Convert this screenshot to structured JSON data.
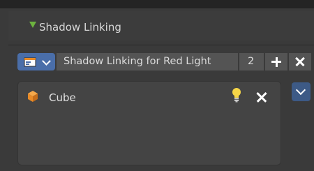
{
  "panel": {
    "title": "Shadow Linking"
  },
  "toolbar": {
    "collection_name": "Shadow Linking for Red Light",
    "user_count": "2",
    "add_icon": "plus-icon",
    "remove_icon": "close-icon"
  },
  "list": {
    "items": [
      {
        "label": "Cube",
        "type_icon": "cube-icon",
        "state_icon": "lightbulb-icon",
        "remove_icon": "close-icon"
      }
    ]
  },
  "side": {
    "icon": "chevron-down-icon"
  },
  "colors": {
    "accent_blue": "#4a6ea9",
    "expand_green": "#6db33f",
    "cube_orange": "#e98b28",
    "bulb_yellow": "#f5d547"
  }
}
